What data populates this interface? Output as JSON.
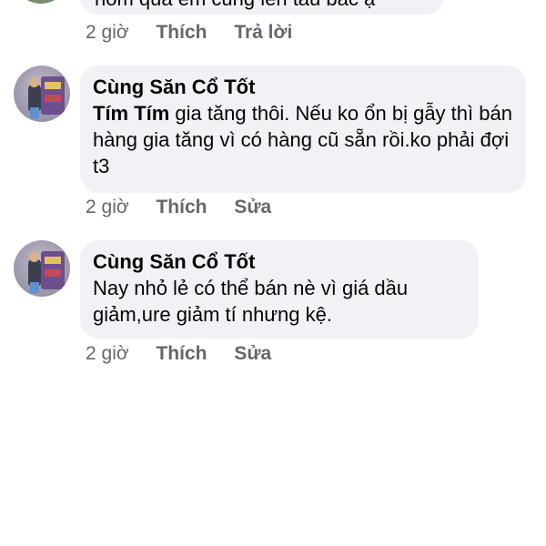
{
  "top_comment": {
    "text_partial": "hôm qua em cũng lên tàu bác ạ",
    "time": "2 giờ",
    "like_label": "Thích",
    "action_label": "Trả lời"
  },
  "comments": [
    {
      "author": "Cùng Săn Cổ Tốt",
      "mention": "Tím Tím",
      "body": "gia tăng thôi. Nếu ko ổn bị gẫy thì bán hàng gia tăng vì có hàng cũ sẵn rồi.ko phải đợi t3",
      "time": "2 giờ",
      "like_label": "Thích",
      "action_label": "Sửa"
    },
    {
      "author": "Cùng Săn Cổ Tốt",
      "body": "Nay nhỏ lẻ có thể bán nè vì giá dầu giảm,ure giảm tí nhưng kệ.",
      "time": "2 giờ",
      "like_label": "Thích",
      "action_label": "Sửa"
    }
  ]
}
